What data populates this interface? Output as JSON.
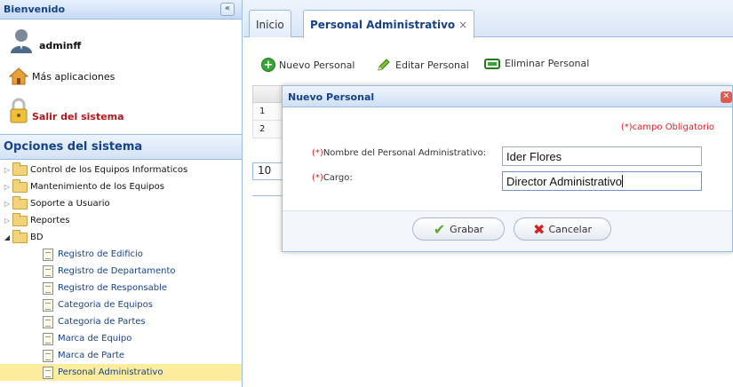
{
  "sidebar": {
    "header_title": "Bienvenido",
    "collapse_icon": "«",
    "user": {
      "name": "adminff",
      "icon": "user-icon"
    },
    "apps_link": "Más aplicaciones",
    "logout": "Salir del sistema",
    "options_title": "Opciones del sistema",
    "tree": {
      "folders": [
        "Control de los Equipos Informaticos",
        "Mantenimiento de los Equipos",
        "Soporte a Usuario",
        "Reportes",
        "BD"
      ],
      "bd_items": [
        "Registro de Edificio",
        "Registro de Departamento",
        "Registro de Responsable",
        "Categoria de Equipos",
        "Categoria de Partes",
        "Marca de Equipo",
        "Marca de Parte",
        "Personal Administrativo"
      ],
      "selected": "Personal Administrativo"
    }
  },
  "tabs": {
    "home": "Inicio",
    "active": "Personal Administrativo",
    "close": "×"
  },
  "toolbar": {
    "new": "Nuevo Personal",
    "edit": "Editar Personal",
    "delete": "Eliminar Personal"
  },
  "grid": {
    "rows": [
      "1",
      "2"
    ],
    "page_size": "10"
  },
  "dialog": {
    "title": "Nuevo Personal",
    "required_note": "(*)campo Obligatorio",
    "name_label_req": "(*)",
    "name_label": "Nombre del Personal Administrativo:",
    "name_value": "Ider Flores",
    "cargo_label_req": "(*)",
    "cargo_label": "Cargo:",
    "cargo_value": "Director Administrativo",
    "save": "Grabar",
    "cancel": "Cancelar"
  },
  "colors": {
    "accent": "#15428b",
    "border": "#99bbe8",
    "required": "#e02020",
    "selected": "#fcec9c"
  }
}
